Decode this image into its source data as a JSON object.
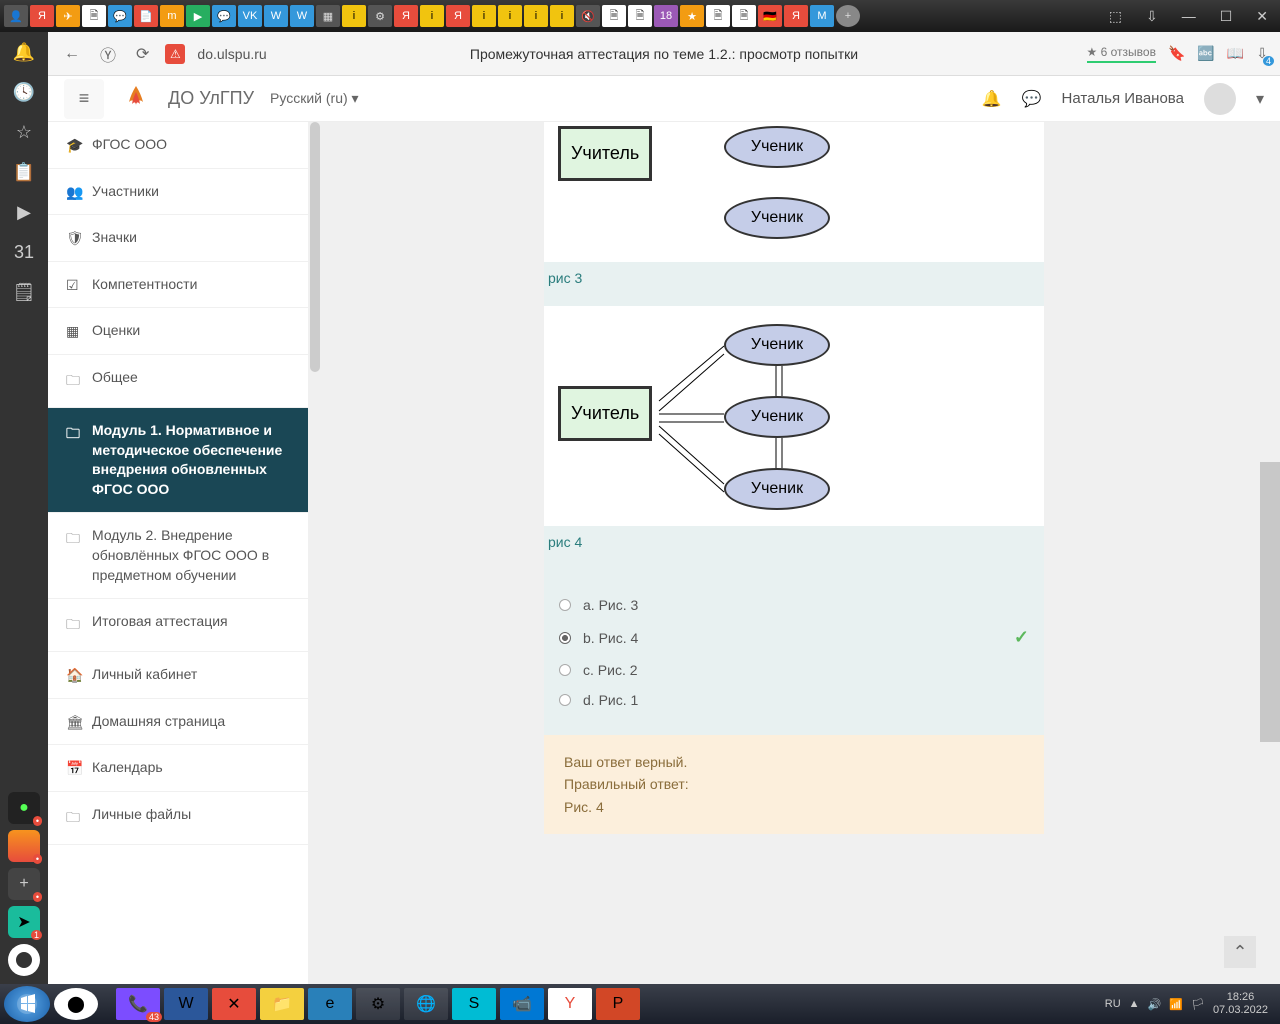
{
  "browser": {
    "url": "do.ulspu.ru",
    "page_title": "Промежуточная аттестация по теме 1.2.: просмотр попытки",
    "reviews": "★ 6 отзывов",
    "download_badge": "4"
  },
  "moodle": {
    "site_name": "ДО УлГПУ",
    "language": "Русский (ru) ▾",
    "user_name": "Наталья Иванова"
  },
  "nav": {
    "items": [
      {
        "icon": "🎓",
        "label": "ФГОС ООО"
      },
      {
        "icon": "👥",
        "label": "Участники"
      },
      {
        "icon": "🛡",
        "label": "Значки"
      },
      {
        "icon": "☑",
        "label": "Компетентности"
      },
      {
        "icon": "▦",
        "label": "Оценки"
      },
      {
        "icon": "🗀",
        "label": "Общее"
      },
      {
        "icon": "🗀",
        "label": "Модуль 1. Нормативное и методическое обеспечение внедрения обновленных ФГОС ООО"
      },
      {
        "icon": "🗀",
        "label": "Модуль 2. Внедрение обновлённых ФГОС ООО в предметном обучении"
      },
      {
        "icon": "🗀",
        "label": "Итоговая аттестация"
      },
      {
        "icon": "🏠",
        "label": "Личный кабинет"
      },
      {
        "icon": "🏛",
        "label": "Домашняя страница"
      },
      {
        "icon": "📅",
        "label": "Календарь"
      },
      {
        "icon": "🗀",
        "label": "Личные файлы"
      }
    ],
    "active_index": 6
  },
  "diagram": {
    "teacher": "Учитель",
    "student": "Ученик",
    "caption3": "рис 3",
    "caption4": "рис 4"
  },
  "answers": {
    "a": "a. Рис. 3",
    "b": "b. Рис. 4",
    "c": "c. Рис. 2",
    "d": "d. Рис. 1",
    "selected": "b"
  },
  "feedback": {
    "correct_msg": "Ваш ответ верный.",
    "label": "Правильный ответ:",
    "value": "Рис. 4"
  },
  "taskbar": {
    "lang": "RU",
    "time": "18:26",
    "date": "07.03.2022",
    "badge_viber": "43",
    "badge_tg": "1"
  }
}
